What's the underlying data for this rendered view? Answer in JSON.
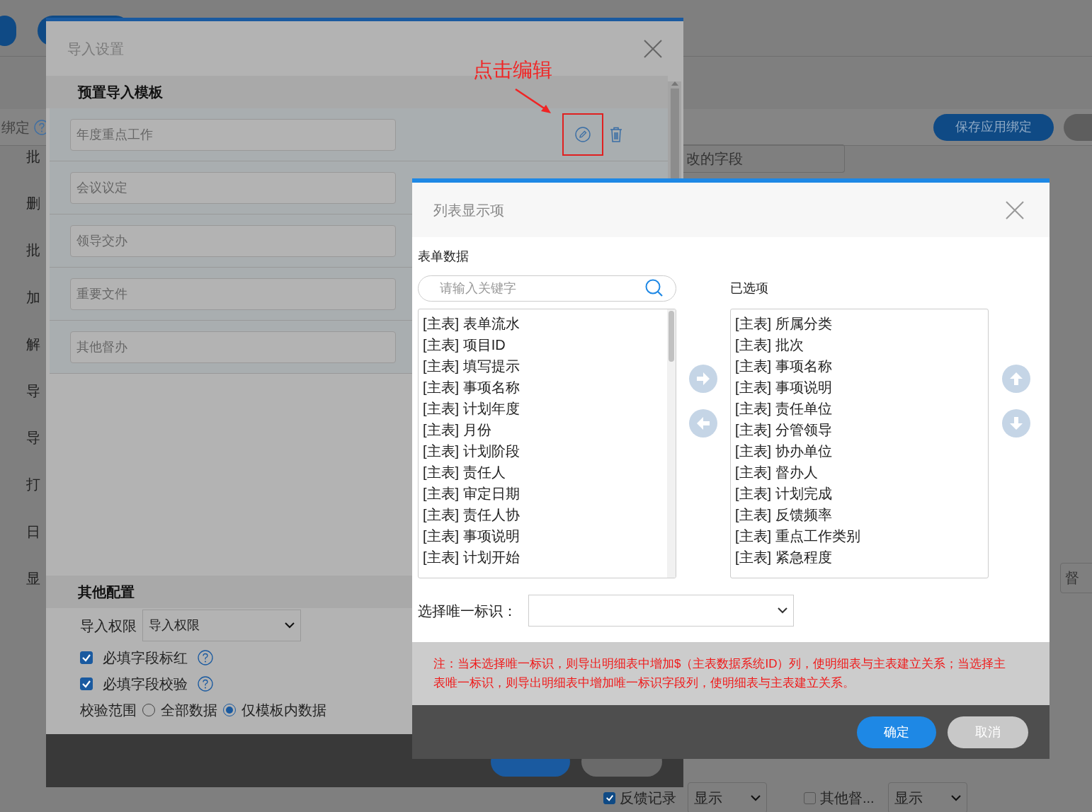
{
  "background": {
    "binding_label": "绑定",
    "save_button": "保存应用绑定",
    "side_items": [
      "批",
      "删",
      "批",
      "加",
      "解",
      "导",
      "导",
      "打",
      "日",
      "显"
    ],
    "field_value": "改的字段",
    "right_field_value": "督",
    "bottom_fields": [
      {
        "label": "反馈记录",
        "checked": true,
        "value": "显示"
      },
      {
        "label": "其他督...",
        "checked": false,
        "value": "显示"
      }
    ]
  },
  "import_dialog": {
    "title": "导入设置",
    "templates_heading": "预置导入模板",
    "templates": [
      {
        "name": "年度重点工作"
      },
      {
        "name": "会议议定"
      },
      {
        "name": "领导交办"
      },
      {
        "name": "重要文件"
      },
      {
        "name": "其他督办"
      }
    ],
    "other_heading": "其他配置",
    "permission": {
      "label": "导入权限",
      "value": "导入权限"
    },
    "checks": [
      {
        "label": "必填字段标红",
        "checked": true
      },
      {
        "label": "必填字段校验",
        "checked": true
      }
    ],
    "scope": {
      "label": "校验范围",
      "options": [
        {
          "label": "全部数据",
          "selected": false
        },
        {
          "label": "仅模板内数据",
          "selected": true
        }
      ]
    }
  },
  "annotation": {
    "text": "点击编辑"
  },
  "list_dialog": {
    "title": "列表显示项",
    "source_label": "表单数据",
    "search": {
      "placeholder": "请输入关键字"
    },
    "selected_label": "已选项",
    "source_items": [
      "[主表] 表单流水",
      "[主表] 项目ID",
      "[主表] 填写提示",
      "[主表] 事项名称",
      "[主表] 计划年度",
      "[主表] 月份",
      "[主表] 计划阶段",
      "[主表] 责任人",
      "[主表] 审定日期",
      "[主表] 责任人协",
      "[主表] 事项说明",
      "[主表] 计划开始"
    ],
    "selected_items": [
      "[主表] 所属分类",
      "[主表] 批次",
      "[主表] 事项名称",
      "[主表] 事项说明",
      "[主表] 责任单位",
      "[主表] 分管领导",
      "[主表] 协办单位",
      "[主表] 督办人",
      "[主表] 计划完成",
      "[主表] 反馈频率",
      "[主表] 重点工作类别",
      "[主表] 紧急程度"
    ],
    "unique_label": "选择唯一标识：",
    "note": "注：当未选择唯一标识，则导出明细表中增加$（主表数据系统ID）列，使明细表与主表建立关系；当选择主表唯一标识，则导出明细表中增加唯一标识字段列，使明细表与主表建立关系。",
    "buttons": [
      {
        "label": "确定",
        "kind": "primary"
      },
      {
        "label": "取消",
        "kind": "secondary"
      }
    ]
  }
}
